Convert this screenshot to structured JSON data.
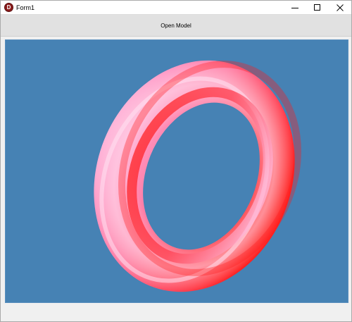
{
  "window": {
    "title": "Form1",
    "icon": "delphi-app-icon",
    "icon_letter": "D"
  },
  "toolbar": {
    "open_model_label": "Open Model"
  },
  "viewport": {
    "background_color": "#4682b4",
    "model": "torus",
    "model_colors": {
      "highlight": "#ffc8e8",
      "base": "#ff7aa6",
      "shadow": "#ff2020"
    }
  }
}
